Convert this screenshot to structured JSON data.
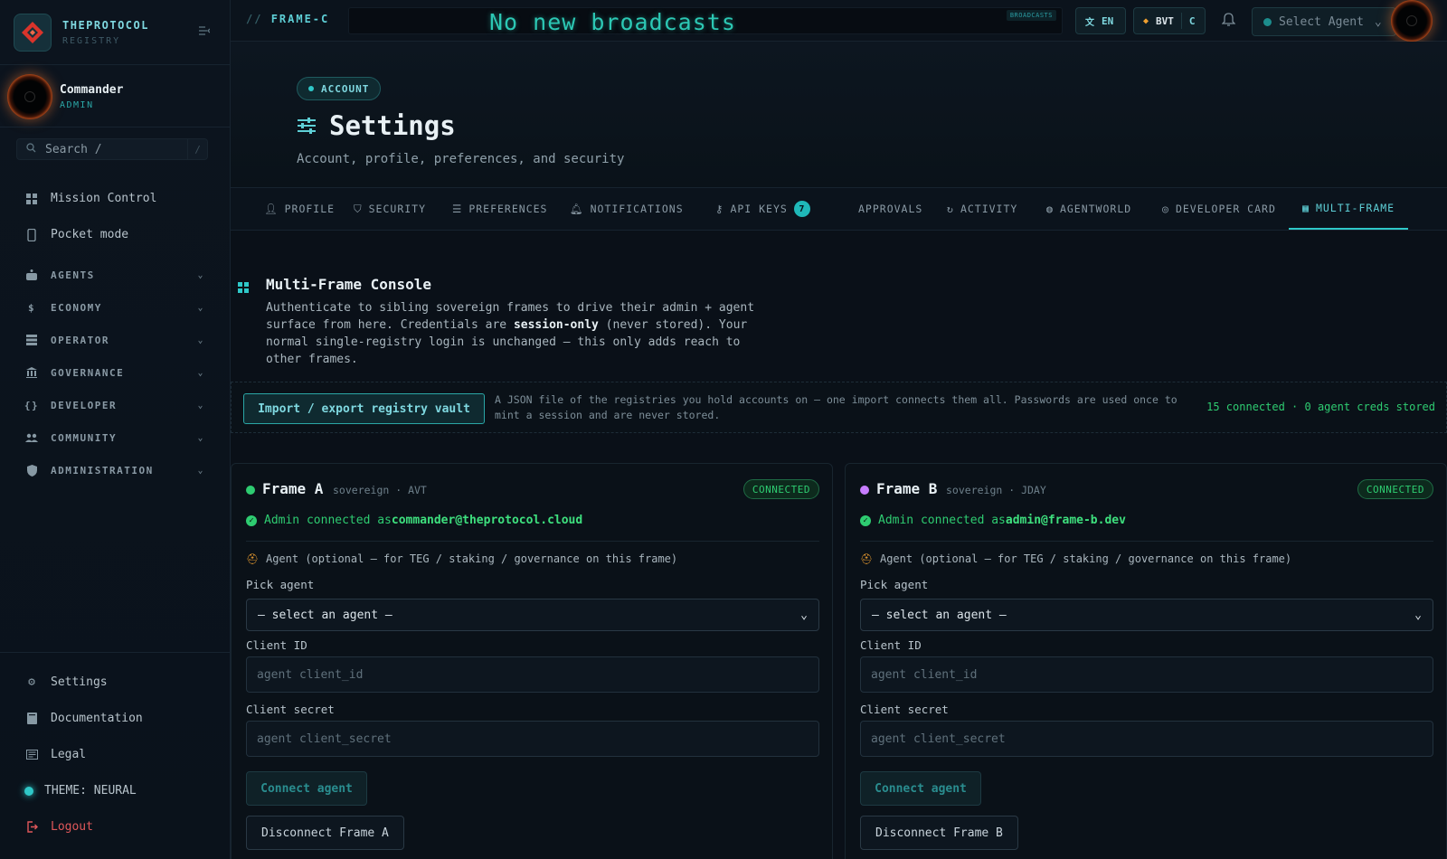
{
  "brand": {
    "title": "THEPROTOCOL",
    "subtitle": "REGISTRY"
  },
  "user": {
    "name": "Commander",
    "role": "ADMIN"
  },
  "search": {
    "label": "Search  /",
    "shortcut": "/"
  },
  "sidebar": {
    "primary": [
      {
        "label": "Mission Control",
        "icon": "grid-icon"
      },
      {
        "label": "Pocket mode",
        "icon": "phone-icon"
      }
    ],
    "groups": [
      {
        "label": "AGENTS",
        "icon": "robot-icon"
      },
      {
        "label": "ECONOMY",
        "icon": "dollar-icon"
      },
      {
        "label": "OPERATOR",
        "icon": "server-icon"
      },
      {
        "label": "GOVERNANCE",
        "icon": "building-icon"
      },
      {
        "label": "DEVELOPER",
        "icon": "braces-icon"
      },
      {
        "label": "COMMUNITY",
        "icon": "people-icon"
      },
      {
        "label": "ADMINISTRATION",
        "icon": "shield-icon"
      }
    ],
    "bottom": [
      {
        "label": "Settings",
        "icon": "gear-icon"
      },
      {
        "label": "Documentation",
        "icon": "book-icon"
      },
      {
        "label": "Legal",
        "icon": "document-icon"
      }
    ],
    "theme": "THEME: NEURAL",
    "logout": "Logout"
  },
  "topbar": {
    "frame_slash": "//",
    "frame": "FRAME-C",
    "broadcast": "No new broadcasts",
    "broadcast_tag": "BROADCASTS",
    "language": "EN",
    "token": "BVT",
    "token_suffix": "C",
    "select_agent": "Select Agent"
  },
  "header": {
    "badge": "ACCOUNT",
    "title": "Settings",
    "subtitle": "Account, profile, preferences, and security"
  },
  "tabs": [
    {
      "label": "PROFILE",
      "icon": "person-icon"
    },
    {
      "label": "SECURITY",
      "icon": "shield-icon"
    },
    {
      "label": "PREFERENCES",
      "icon": "sliders-icon"
    },
    {
      "label": "NOTIFICATIONS",
      "icon": "bell-icon"
    },
    {
      "label": "API KEYS",
      "icon": "key-icon",
      "badge": "7"
    },
    {
      "label": "APPROVALS",
      "icon": ""
    },
    {
      "label": "ACTIVITY",
      "icon": "history-icon"
    },
    {
      "label": "AGENTWORLD",
      "icon": "globe-icon"
    },
    {
      "label": "DEVELOPER CARD",
      "icon": "fingerprint-icon"
    },
    {
      "label": "MULTI-FRAME",
      "icon": "grid-icon",
      "active": true
    }
  ],
  "multiframe": {
    "title": "Multi-Frame Console",
    "desc_1": "Authenticate to sibling sovereign frames to drive their admin + agent surface from here. Credentials are ",
    "desc_bold": "session-only",
    "desc_2": " (never stored). Your normal single-registry login is unchanged — this only adds reach to other frames."
  },
  "vault": {
    "button": "Import / export registry vault",
    "description": "A JSON file of the registries you hold accounts on — one import connects them all. Passwords are used once to mint a session and are never stored.",
    "status": "15 connected · 0 agent creds stored"
  },
  "frames": [
    {
      "name": "Frame A",
      "meta": "sovereign · AVT",
      "status": "CONNECTED",
      "dot_color": "#2ecc71",
      "admin_prefix": "Admin connected as ",
      "admin_email": "commander@theprotocol.cloud",
      "agent_note": "Agent (optional — for TEG / staking / governance on this frame)",
      "pick_label": "Pick agent",
      "select_value": "— select an agent —",
      "client_id_label": "Client ID",
      "client_id_placeholder": "agent client_id",
      "client_secret_label": "Client secret",
      "client_secret_placeholder": "agent client_secret",
      "connect": "Connect agent",
      "disconnect": "Disconnect Frame A"
    },
    {
      "name": "Frame B",
      "meta": "sovereign · JDAY",
      "status": "CONNECTED",
      "dot_color": "#c77dff",
      "admin_prefix": "Admin connected as ",
      "admin_email": "admin@frame-b.dev",
      "agent_note": "Agent (optional — for TEG / staking / governance on this frame)",
      "pick_label": "Pick agent",
      "select_value": "— select an agent —",
      "client_id_label": "Client ID",
      "client_id_placeholder": "agent client_id",
      "client_secret_label": "Client secret",
      "client_secret_placeholder": "agent client_secret",
      "connect": "Connect agent",
      "disconnect": "Disconnect Frame B"
    }
  ],
  "colors": {
    "accent": "#2fc8c8",
    "success": "#2ecc71",
    "danger": "#e0575a"
  }
}
